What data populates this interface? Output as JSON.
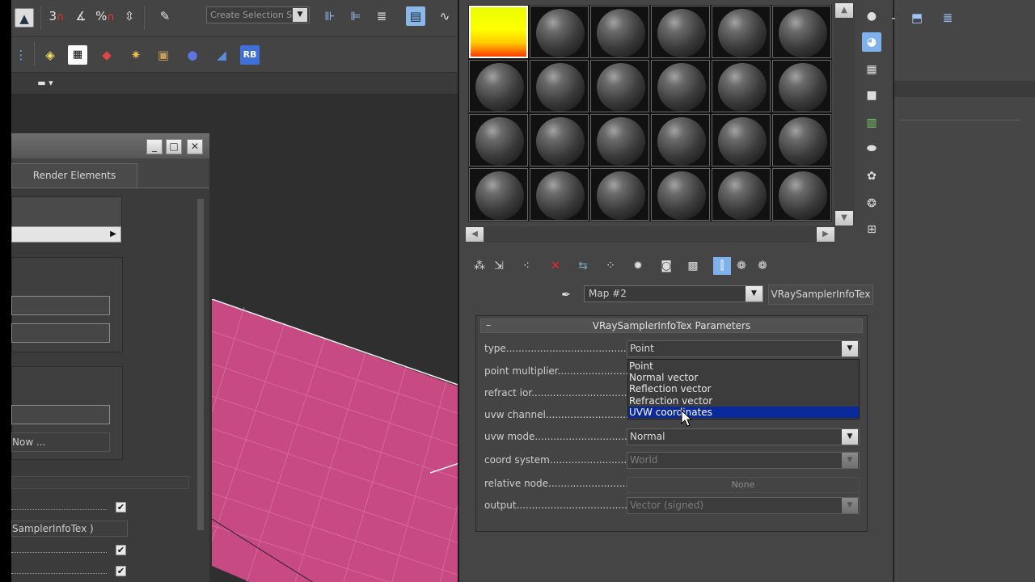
{
  "toolbar": {
    "selection_set_placeholder": "Create Selection Se",
    "snap_3": "3",
    "snap_percent": "%",
    "rb_label": "RB"
  },
  "render_dialog": {
    "tab_render_elements": "Render Elements",
    "now_button": "Now ...",
    "sampler_label": "SamplerInfoTex )",
    "checks": [
      "✔",
      "✔",
      "✔"
    ]
  },
  "material_editor": {
    "map_name": "Map #2",
    "map_type": "VRaySamplerInfoTex",
    "rollout_title": "VRaySamplerInfoTex Parameters",
    "rollout_collapse": "–",
    "params": {
      "type": {
        "label": "type.........................................",
        "value": "Point"
      },
      "point_multiplier": {
        "label": "point multiplier.................................."
      },
      "refract_ior": {
        "label": "refract ior......................................"
      },
      "uvw_channel": {
        "label": "uvw channel......................................"
      },
      "uvw_mode": {
        "label": "uvw mode.........................................",
        "value": "Normal"
      },
      "coord_system": {
        "label": "coord system......................................",
        "value": "World"
      },
      "relative_node": {
        "label": "relative node......................................",
        "value": "None"
      },
      "output": {
        "label": "output...........................................",
        "value": "Vector (signed)"
      }
    },
    "type_dropdown": {
      "options": [
        "Point",
        "Normal vector",
        "Reflection vector",
        "Refraction vector",
        "UVW coordinates"
      ],
      "highlighted": "UVW coordinates"
    }
  }
}
